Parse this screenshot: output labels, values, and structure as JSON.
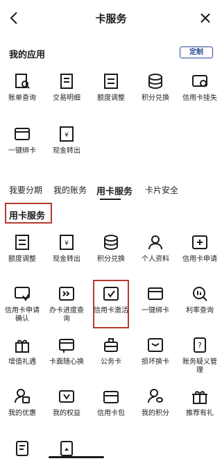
{
  "header": {
    "title": "卡服务"
  },
  "my_apps": {
    "heading": "我的应用",
    "customize_label": "定制",
    "items": [
      {
        "label": "账单查询",
        "icon": "bill-search-icon"
      },
      {
        "label": "交易明细",
        "icon": "transaction-detail-icon"
      },
      {
        "label": "额度调整",
        "icon": "limit-adjust-icon"
      },
      {
        "label": "积分兑换",
        "icon": "points-exchange-icon"
      },
      {
        "label": "信用卡挂失",
        "icon": "report-loss-icon"
      },
      {
        "label": "一键绑卡",
        "icon": "bind-card-icon"
      },
      {
        "label": "现金转出",
        "icon": "cash-out-icon"
      }
    ]
  },
  "tabs": [
    {
      "label": "我要分期"
    },
    {
      "label": "我的账务"
    },
    {
      "label": "用卡服务"
    },
    {
      "label": "卡片安全"
    }
  ],
  "card_service": {
    "heading": "用卡服务",
    "items": [
      {
        "label": "额度调整",
        "icon": "limit-adjust-icon"
      },
      {
        "label": "现金转出",
        "icon": "cash-out-icon"
      },
      {
        "label": "积分兑换",
        "icon": "points-exchange-icon"
      },
      {
        "label": "个人资料",
        "icon": "profile-icon"
      },
      {
        "label": "信用卡申请",
        "icon": "card-apply-icon"
      },
      {
        "label": "信用卡申请确认",
        "icon": "apply-confirm-icon"
      },
      {
        "label": "办卡进度查询",
        "icon": "progress-query-icon"
      },
      {
        "label": "信用卡激活",
        "icon": "card-activate-icon"
      },
      {
        "label": "一键绑卡",
        "icon": "bind-card-icon"
      },
      {
        "label": "利率查询",
        "icon": "rate-query-icon"
      },
      {
        "label": "增值礼遇",
        "icon": "gift-icon"
      },
      {
        "label": "卡面随心换",
        "icon": "card-face-icon"
      },
      {
        "label": "公务卡",
        "icon": "business-card-icon"
      },
      {
        "label": "损坏换卡",
        "icon": "replace-card-icon"
      },
      {
        "label": "账务疑义管理",
        "icon": "dispute-icon"
      },
      {
        "label": "我的优惠",
        "icon": "my-discount-icon"
      },
      {
        "label": "我的权益",
        "icon": "my-rights-icon"
      },
      {
        "label": "信用卡包",
        "icon": "card-wallet-icon"
      },
      {
        "label": "我的积分",
        "icon": "my-points-icon"
      },
      {
        "label": "推荐有礼",
        "icon": "referral-gift-icon"
      }
    ]
  },
  "colors": {
    "accent": "#2a4b99",
    "highlight": "#b53a2e",
    "text": "#1a1a1a"
  }
}
